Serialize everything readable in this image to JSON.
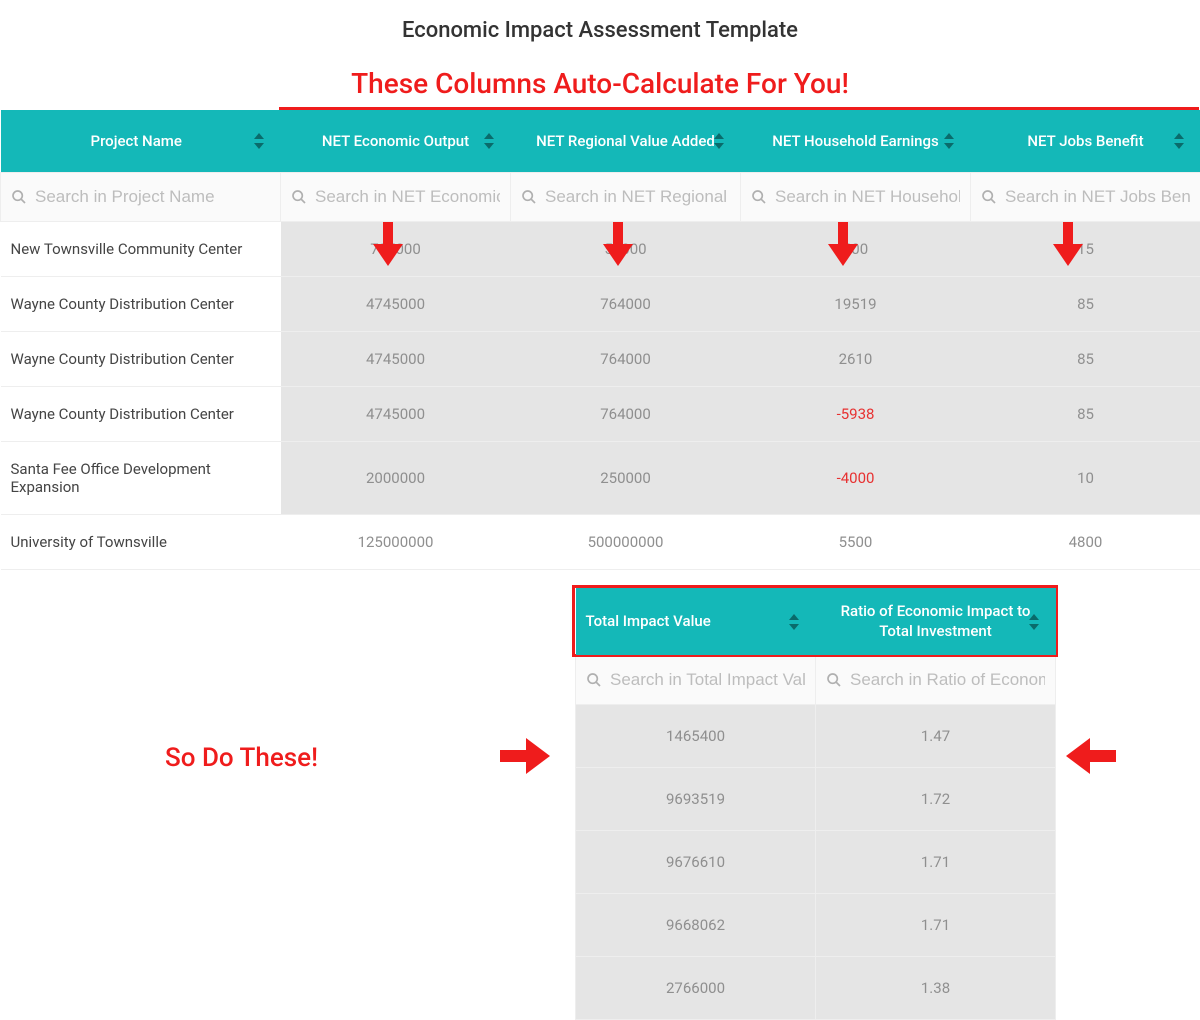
{
  "title": "Economic Impact Assessment Template",
  "annotations": {
    "top": "These Columns Auto-Calculate For You!",
    "bottom": "So Do These!"
  },
  "table1": {
    "headers": {
      "c0": "Project Name",
      "c1": "NET Economic Output",
      "c2": "NET Regional Value Added",
      "c3": "NET Household Earnings",
      "c4": "NET Jobs Benefit"
    },
    "placeholders": {
      "c0": "Search in Project Name",
      "c1": "Search in NET Economic Output",
      "c2": "Search in NET Regional Value Added",
      "c3": "Search in NET Household Earnings",
      "c4": "Search in NET Jobs Benefit"
    },
    "rows": [
      {
        "name": "New Townsville Community Center",
        "c1": "705000",
        "c2": "55000",
        "c3": "400",
        "c4": "15"
      },
      {
        "name": "Wayne County Distribution Center",
        "c1": "4745000",
        "c2": "764000",
        "c3": "19519",
        "c4": "85"
      },
      {
        "name": "Wayne County Distribution Center",
        "c1": "4745000",
        "c2": "764000",
        "c3": "2610",
        "c4": "85"
      },
      {
        "name": "Wayne County Distribution Center",
        "c1": "4745000",
        "c2": "764000",
        "c3": "-5938",
        "c4": "85"
      },
      {
        "name": "Santa Fee Office Development Expansion",
        "c1": "2000000",
        "c2": "250000",
        "c3": "-4000",
        "c4": "10"
      },
      {
        "name": "University of Townsville",
        "c1": "125000000",
        "c2": "500000000",
        "c3": "5500",
        "c4": "4800"
      }
    ]
  },
  "table2": {
    "headers": {
      "c0": "Total Impact Value",
      "c1": "Ratio of Economic Impact to Total Investment"
    },
    "placeholders": {
      "c0": "Search in Total Impact Value",
      "c1": "Search in Ratio of Economic Impact"
    },
    "rows": [
      {
        "c0": "1465400",
        "c1": "1.47"
      },
      {
        "c0": "9693519",
        "c1": "1.72"
      },
      {
        "c0": "9676610",
        "c1": "1.71"
      },
      {
        "c0": "9668062",
        "c1": "1.71"
      },
      {
        "c0": "2766000",
        "c1": "1.38"
      }
    ]
  }
}
